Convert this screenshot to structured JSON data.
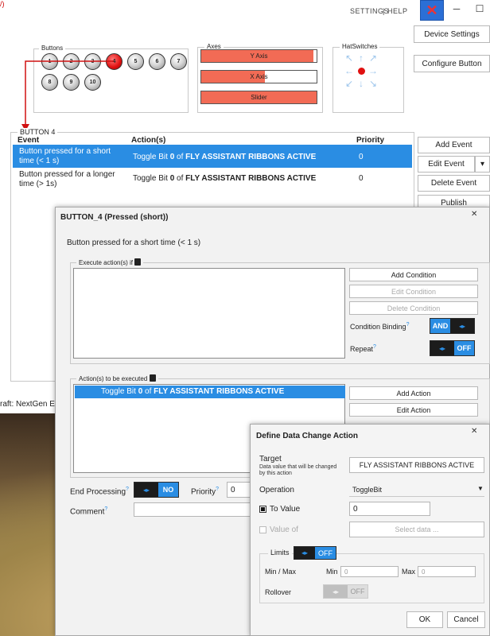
{
  "topbar": {
    "settings": "SETTINGS",
    "sep": "|",
    "help": "HELP",
    "close_glyph": "✕",
    "min_glyph": "─",
    "max_glyph": "☐",
    "corner_fragment": "/)"
  },
  "right_buttons": {
    "device_settings": "Device Settings",
    "configure_button": "Configure Button"
  },
  "buttons_group": {
    "title": "Buttons",
    "buttons": [
      "1",
      "2",
      "3",
      "4",
      "5",
      "6",
      "7",
      "8",
      "9",
      "10"
    ],
    "active_index": 3
  },
  "axes_group": {
    "title": "Axes",
    "axes": [
      {
        "label": "Y Axis",
        "fill": 0.97
      },
      {
        "label": "X Axis",
        "fill": 0.55
      },
      {
        "label": "Slider",
        "fill": 1.0
      }
    ]
  },
  "hat_group": {
    "title": "HatSwitches"
  },
  "events": {
    "group_title": "BUTTON 4",
    "columns": {
      "event": "Event",
      "actions": "Action(s)",
      "priority": "Priority"
    },
    "rows": [
      {
        "event_line1": "Button pressed for a short",
        "event_line2": "time (< 1 s)",
        "action_pre": "Toggle Bit ",
        "action_bit": "0",
        "action_mid": " of ",
        "action_var": "FLY ASSISTANT RIBBONS ACTIVE",
        "priority": "0"
      },
      {
        "event_line1": "Button pressed for a longer",
        "event_line2": "time (> 1s)",
        "action_pre": "Toggle Bit ",
        "action_bit": "0",
        "action_mid": " of ",
        "action_var": "FLY ASSISTANT RIBBONS ACTIVE",
        "priority": "0"
      }
    ],
    "add_event": "Add Event",
    "edit_event": "Edit Event",
    "delete_event": "Delete Event",
    "publish": "Publish",
    "dropdown_glyph": "▾"
  },
  "background": {
    "status_fragment": "raft: NextGen EN"
  },
  "dialog1": {
    "title": "BUTTON_4 (Pressed (short))",
    "subtitle": "Button pressed for a short time (< 1 s)",
    "exec_if_title": "Execute action(s) if",
    "add_condition": "Add Condition",
    "edit_condition": "Edit Condition",
    "delete_condition": "Delete Condition",
    "condition_binding_label": "Condition Binding",
    "condition_binding_value": "AND",
    "repeat_label": "Repeat",
    "repeat_value": "OFF",
    "actions_title": "Action(s) to be executed",
    "action_item": {
      "pre": "Toggle Bit ",
      "bit": "0",
      "mid": " of ",
      "var": "FLY ASSISTANT RIBBONS ACTIVE"
    },
    "add_action": "Add Action",
    "edit_action": "Edit Action",
    "end_processing_label": "End Processing",
    "end_processing_value": "NO",
    "priority_label": "Priority",
    "priority_value": "0",
    "comment_label": "Comment",
    "qmark": "?",
    "close_glyph": "✕"
  },
  "dialog2": {
    "title": "Define Data Change Action",
    "target_label": "Target",
    "target_hint_line1": "Data value that will be changed",
    "target_hint_line2": "by this action",
    "target_value": "FLY ASSISTANT RIBBONS ACTIVE",
    "operation_label": "Operation",
    "operation_value": "ToggleBit",
    "to_value_label": "To Value",
    "to_value": "0",
    "value_of_label": "Value of",
    "select_data": "Select data ...",
    "limits_label": "Limits",
    "limits_value": "OFF",
    "minmax_label": "Min / Max",
    "min_label": "Min",
    "min_placeholder": "0",
    "max_label": "Max",
    "max_placeholder": "0",
    "rollover_label": "Rollover",
    "rollover_value": "OFF",
    "ok": "OK",
    "cancel": "Cancel",
    "close_glyph": "✕"
  },
  "colors": {
    "accent": "#2a8de3",
    "active_red": "#e01010",
    "axis_fill": "#f26b55"
  }
}
